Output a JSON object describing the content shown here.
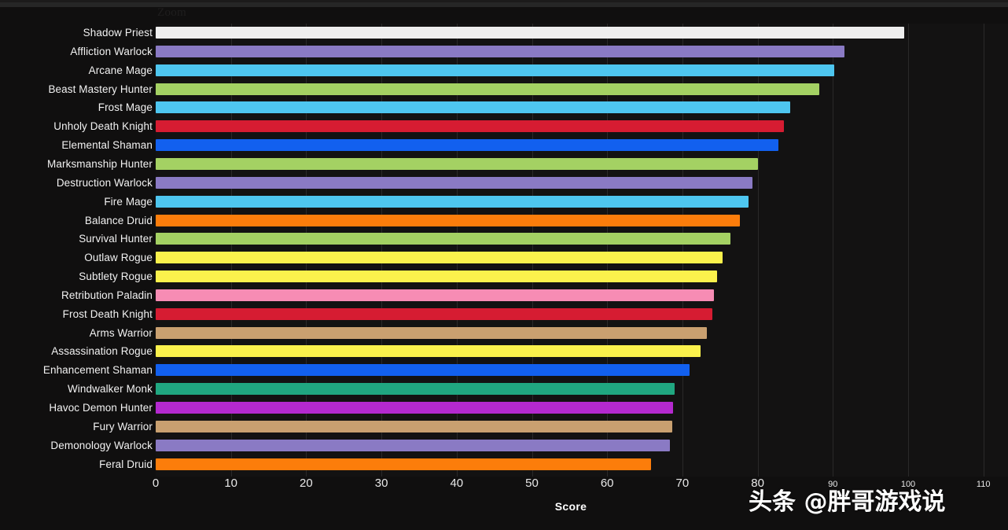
{
  "window": {
    "zoom_label": "Zoom"
  },
  "watermark": {
    "text": "头条 @胖哥游戏说"
  },
  "axis": {
    "xlabel": "Score",
    "ticks": [
      "0",
      "10",
      "20",
      "30",
      "40",
      "50",
      "60",
      "70",
      "80",
      "90",
      "100",
      "110"
    ],
    "tick_values": [
      0,
      10,
      20,
      30,
      40,
      50,
      60,
      70,
      80,
      90,
      100,
      110
    ]
  },
  "chart_data": {
    "type": "bar",
    "orientation": "horizontal",
    "title": "",
    "xlabel": "Score",
    "ylabel": "",
    "xlim": [
      0,
      113
    ],
    "grid": true,
    "legend": "none",
    "categories": [
      "Shadow Priest",
      "Affliction Warlock",
      "Arcane Mage",
      "Beast Mastery Hunter",
      "Frost Mage",
      "Unholy Death Knight",
      "Elemental Shaman",
      "Marksmanship Hunter",
      "Destruction Warlock",
      "Fire Mage",
      "Balance Druid",
      "Survival Hunter",
      "Outlaw Rogue",
      "Subtlety Rogue",
      "Retribution Paladin",
      "Frost Death Knight",
      "Arms Warrior",
      "Assassination Rogue",
      "Enhancement Shaman",
      "Windwalker Monk",
      "Havoc Demon Hunter",
      "Fury Warrior",
      "Demonology Warlock",
      "Feral Druid"
    ],
    "values": [
      99.5,
      91.5,
      90.2,
      88.2,
      84.3,
      83.5,
      82.8,
      80.0,
      79.3,
      78.8,
      77.6,
      76.4,
      75.3,
      74.6,
      74.2,
      74.0,
      73.3,
      72.4,
      71.0,
      69.0,
      68.8,
      68.6,
      68.3,
      65.8
    ],
    "colors": [
      "#eeeeee",
      "#8a7ac4",
      "#4ec6ef",
      "#a4d163",
      "#4ec6ef",
      "#d61c32",
      "#1260ef",
      "#a4d163",
      "#8a7ac4",
      "#4ec6ef",
      "#fc7d0b",
      "#a4d163",
      "#fbf14c",
      "#fbf14c",
      "#f78cb4",
      "#d61c32",
      "#c9a070",
      "#fbf14c",
      "#1260ef",
      "#20a780",
      "#b429cf",
      "#c9a070",
      "#8a7ac4",
      "#fc7d0b"
    ],
    "class_names": [
      "Priest",
      "Warlock",
      "Mage",
      "Hunter",
      "Mage",
      "Death Knight",
      "Shaman",
      "Hunter",
      "Warlock",
      "Mage",
      "Druid",
      "Hunter",
      "Rogue",
      "Rogue",
      "Paladin",
      "Death Knight",
      "Warrior",
      "Rogue",
      "Shaman",
      "Monk",
      "Demon Hunter",
      "Warrior",
      "Warlock",
      "Druid"
    ]
  },
  "theme": {
    "background": "#100f0f",
    "plot_background": "#131212",
    "gridline": "#2a2929",
    "text": "#f2f2f2"
  }
}
